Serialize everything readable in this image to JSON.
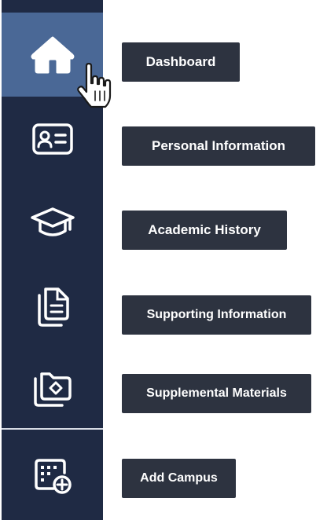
{
  "sidebar": {
    "items": [
      {
        "id": "dashboard",
        "icon": "home-icon",
        "label": "Dashboard",
        "active": true
      },
      {
        "id": "personal-information",
        "icon": "id-card-icon",
        "label": "Personal Information",
        "active": false
      },
      {
        "id": "academic-history",
        "icon": "graduation-cap-icon",
        "label": "Academic History",
        "active": false
      },
      {
        "id": "supporting-information",
        "icon": "documents-icon",
        "label": "Supporting Information",
        "active": false
      },
      {
        "id": "supplemental-materials",
        "icon": "folder-diamond-icon",
        "label": "Supplemental Materials",
        "active": false
      },
      {
        "id": "add-campus",
        "icon": "calendar-add-icon",
        "label": "Add Campus",
        "active": false
      }
    ]
  },
  "colors": {
    "sidebar_bg": "#1f2a44",
    "active_bg": "#4a6896",
    "tooltip_bg": "#2d3340",
    "icon": "#ffffff"
  },
  "cursor": "hand-pointer-icon"
}
